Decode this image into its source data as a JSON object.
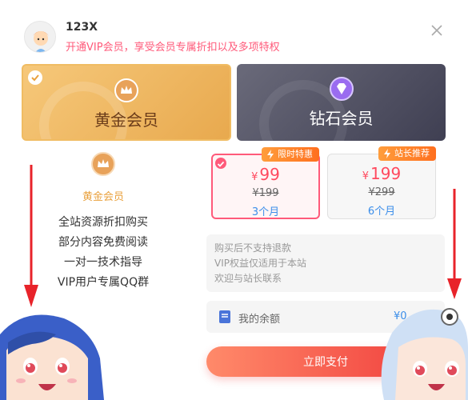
{
  "user": {
    "name": "123X",
    "subtitle": "开通VIP会员，享受会员专属折扣以及多项特权"
  },
  "plans": [
    {
      "label": "黄金会员",
      "selected": true
    },
    {
      "label": "钻石会员",
      "selected": false
    }
  ],
  "selected_plan": {
    "title": "黄金会员",
    "features": [
      "全站资源折扣购买",
      "部分内容免费阅读",
      "一对一技术指导",
      "VIP用户专属QQ群"
    ]
  },
  "prices": [
    {
      "currency": "¥",
      "price": "99",
      "original": "¥199",
      "period": "3个月",
      "tag": "限时特惠",
      "selected": true
    },
    {
      "currency": "¥",
      "price": "199",
      "original": "¥299",
      "period": "6个月",
      "tag": "站长推荐",
      "selected": false
    }
  ],
  "notes": [
    "购买后不支持退款",
    "VIP权益仅适用于本站",
    "欢迎与站长联系"
  ],
  "balance": {
    "label": "我的余额",
    "value": "¥0"
  },
  "pay_label": "立即支付",
  "icons": {
    "close": "close-icon",
    "gold_badge": "crown-badge-icon",
    "diamond_badge": "diamond-badge-icon",
    "bolt": "bolt-icon",
    "wallet": "wallet-icon",
    "check": "check-icon"
  },
  "colors": {
    "accent": "#ff5a7a",
    "gold": "#e9a13e",
    "blue": "#3b8eea",
    "pay_start": "#ff8a6a",
    "pay_end": "#f03a3a"
  }
}
